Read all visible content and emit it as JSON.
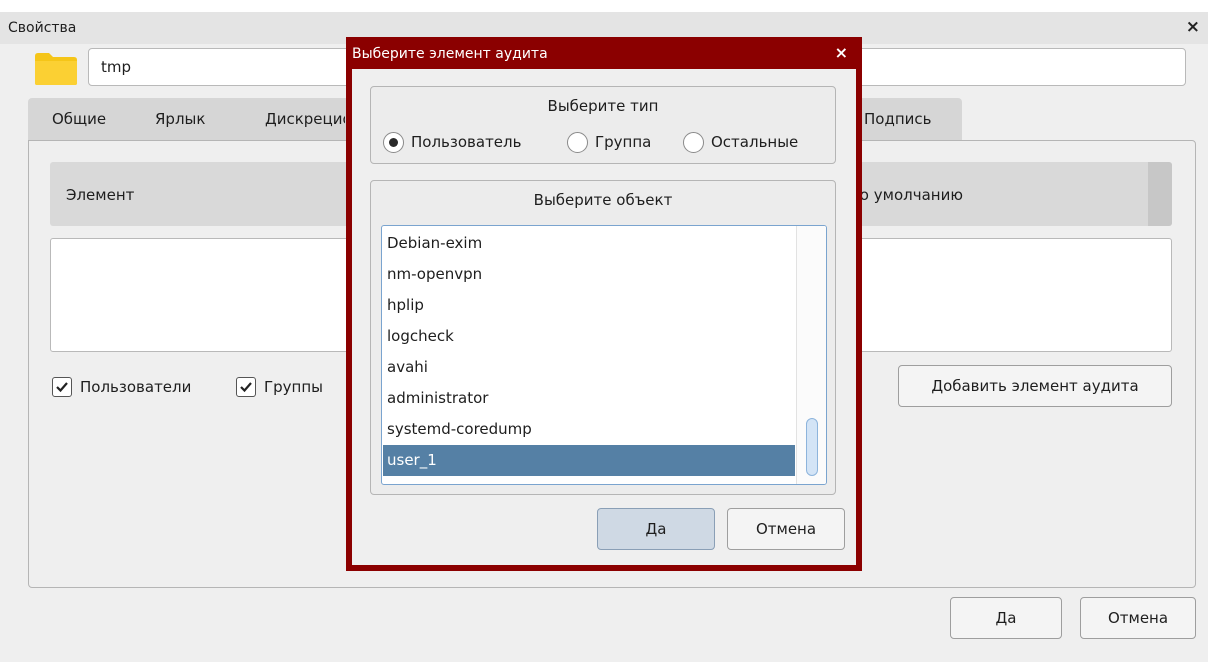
{
  "main_window": {
    "title": "Свойства",
    "close_glyph": "×",
    "name_value": "tmp",
    "tabs": [
      "Общие",
      "Ярлык",
      "Дискреционные",
      "Подпись"
    ],
    "table": {
      "col_element": "Элемент",
      "col_default": "по умолчанию"
    },
    "checkboxes": {
      "users_label": "Пользователи",
      "groups_label": "Группы",
      "users_checked": true,
      "groups_checked": true
    },
    "add_audit_label": "Добавить элемент аудита",
    "ok_label": "Да",
    "cancel_label": "Отмена",
    "folder_icon": "folder-icon"
  },
  "dialog": {
    "title": "Выберите элемент аудита",
    "close_glyph": "×",
    "type_group": {
      "title": "Выберите тип",
      "options": [
        "Пользователь",
        "Группа",
        "Остальные"
      ],
      "selected": "Пользователь"
    },
    "object_group": {
      "title": "Выберите объект",
      "items": [
        "Debian-exim",
        "nm-openvpn",
        "hplip",
        "logcheck",
        "avahi",
        "administrator",
        "systemd-coredump",
        "user_1"
      ],
      "selected": "user_1"
    },
    "ok_label": "Да",
    "cancel_label": "Отмена"
  },
  "colors": {
    "dialog_frame": "#8b0000",
    "selection": "#5580a5",
    "folder": "#f5c518"
  }
}
